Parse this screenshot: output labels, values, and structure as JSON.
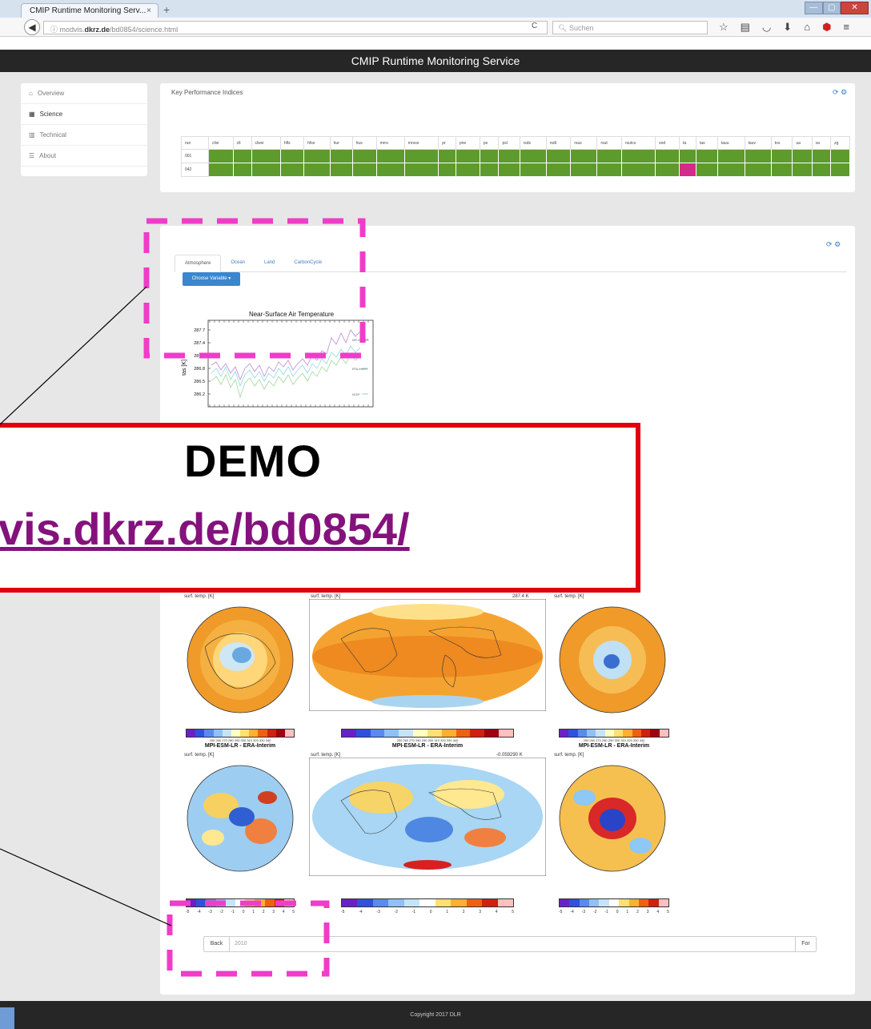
{
  "browser": {
    "tab_title": "CMIP Runtime Monitoring Serv...",
    "tab_close": "×",
    "new_tab": "+",
    "url_prefix": "modvis.",
    "url_domain": "dkrz.de",
    "url_path": "/bd0854/science.html",
    "search_placeholder": "Suchen",
    "reload": "C"
  },
  "header": {
    "title": "CMIP Runtime Monitoring Service"
  },
  "sidebar": {
    "items": [
      {
        "label": "Overview",
        "icon": "home-icon"
      },
      {
        "label": "Science",
        "icon": "grid-icon"
      },
      {
        "label": "Technical",
        "icon": "bar-chart-icon"
      },
      {
        "label": "About",
        "icon": "list-icon"
      }
    ]
  },
  "kpi": {
    "title": "Key Performance Indices",
    "columns": [
      "run",
      "clivi",
      "clt",
      "clwvi",
      "hfls",
      "hfss",
      "hur",
      "hus",
      "mrro",
      "mrsos",
      "pr",
      "prw",
      "ps",
      "psl",
      "rsds",
      "rsdt",
      "rsus",
      "rsut",
      "rsutcs",
      "snd",
      "ta",
      "tas",
      "tauu",
      "tauv",
      "tos",
      "ua",
      "va",
      "zg"
    ],
    "rows": [
      {
        "run": "001",
        "bad": []
      },
      {
        "run": "042",
        "bad": [
          "ta"
        ]
      }
    ],
    "colors": {
      "ok": "#5d9b2c",
      "bad": "#d42a8a"
    }
  },
  "science": {
    "tabs": [
      "Atmosphere",
      "Ocean",
      "Land",
      "CarbonCycle"
    ],
    "choose_button": "Choose Variable",
    "pager": {
      "back": "Back",
      "year": "2010",
      "forward": "For"
    }
  },
  "timeseries": {
    "title": "Near-Surface Air Temperature",
    "ylabel": "tas [K]",
    "yticks": [
      "287.7",
      "287.4",
      "287.1",
      "286.8",
      "286.5",
      "286.2"
    ],
    "legend": [
      "MPI-ESM-LR",
      "ERA-Interim",
      "NCEP"
    ]
  },
  "maps": {
    "row1_labels": {
      "left": "surf. temp. [K]",
      "center": "surf. temp. [K]",
      "center_value": "287.4 K",
      "right": "surf. temp. [K]"
    },
    "row1_caption": "MPI-ESM-LR - ERA-Interim",
    "row1_cbar_ticks": "250 260 270 280 290 300 310 320 330 340",
    "row2_labels": {
      "left": "surf. temp. [K]",
      "center": "surf. temp. [K]",
      "center_value": "-0.059290 K",
      "right": "surf. temp. [K]"
    },
    "row2_cbar_ticks": [
      "-5",
      "-4",
      "-3",
      "-2",
      "-1",
      "0",
      "1",
      "2",
      "3",
      "4",
      "5"
    ]
  },
  "footer": {
    "text": "Copyright 2017 DLR"
  },
  "demo": {
    "title": "DEMO",
    "url": "vis.dkrz.de/bd0854/"
  }
}
